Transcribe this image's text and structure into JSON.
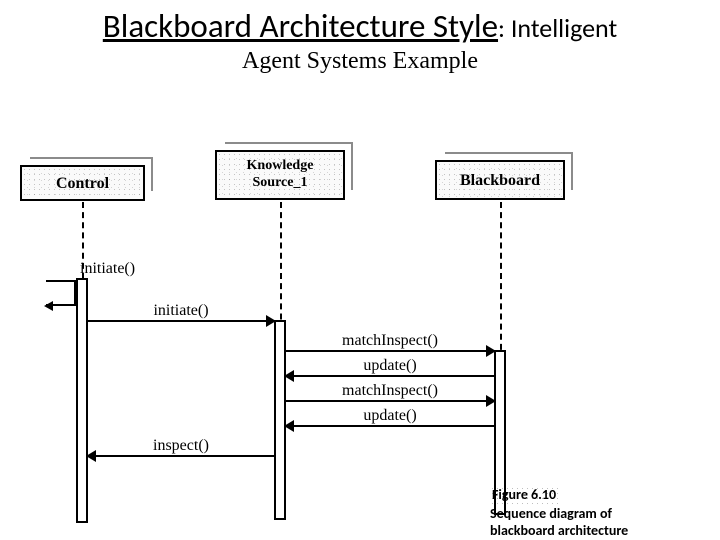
{
  "title": {
    "main_underlined": "Blackboard Architecture Style",
    "main_trailing": ": Intelligent",
    "sub": "Agent Systems Example"
  },
  "actors": {
    "control": "Control",
    "knowledge": "Knowledge\nSource_1",
    "blackboard": "Blackboard"
  },
  "messages": {
    "m1": "initiate()",
    "m2": "initiate()",
    "m3": "matchInspect()",
    "m4": "update()",
    "m5": "matchInspect()",
    "m6": "update()",
    "m7": "inspect()"
  },
  "caption": {
    "fig": "Figure 6.10",
    "line1": "Sequence diagram of",
    "line2": "blackboard architecture"
  },
  "chart_data": {
    "type": "sequence-diagram",
    "participants": [
      "Control",
      "KnowledgeSource_1",
      "Blackboard"
    ],
    "interactions": [
      {
        "from": "Control",
        "to": "Control",
        "label": "initiate()",
        "kind": "self"
      },
      {
        "from": "Control",
        "to": "KnowledgeSource_1",
        "label": "initiate()",
        "kind": "call"
      },
      {
        "from": "KnowledgeSource_1",
        "to": "Blackboard",
        "label": "matchInspect()",
        "kind": "call"
      },
      {
        "from": "Blackboard",
        "to": "KnowledgeSource_1",
        "label": "update()",
        "kind": "return"
      },
      {
        "from": "KnowledgeSource_1",
        "to": "Blackboard",
        "label": "matchInspect()",
        "kind": "call"
      },
      {
        "from": "Blackboard",
        "to": "KnowledgeSource_1",
        "label": "update()",
        "kind": "return"
      },
      {
        "from": "KnowledgeSource_1",
        "to": "Control",
        "label": "inspect()",
        "kind": "return"
      }
    ],
    "caption": "Figure 6.10 — Sequence diagram of blackboard architecture"
  }
}
